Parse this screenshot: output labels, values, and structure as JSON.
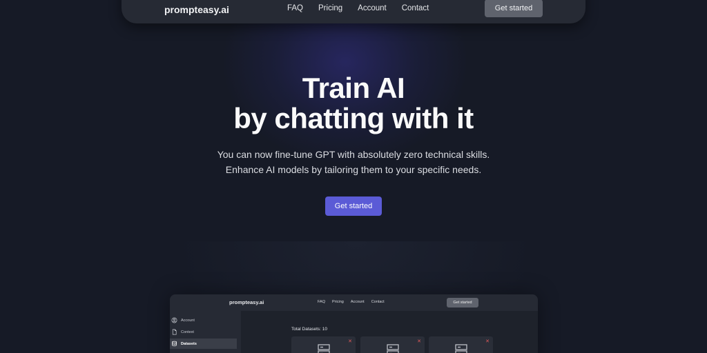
{
  "nav": {
    "logo": "prompteasy.ai",
    "links": [
      "FAQ",
      "Pricing",
      "Account",
      "Contact"
    ],
    "cta": "Get started"
  },
  "hero": {
    "title_line1": "Train AI",
    "title_line2": "by chatting with it",
    "subtitle_line1": "You can now fine-tune GPT with absolutely zero technical skills.",
    "subtitle_line2": "Enhance AI models by tailoring them to your specific needs.",
    "cta": "Get started",
    "cta_color": "#5b5bd6"
  },
  "preview": {
    "logo": "prompteasy.ai",
    "links": [
      "FAQ",
      "Pricing",
      "Account",
      "Contact"
    ],
    "cta": "Get started",
    "sidebar": [
      {
        "label": "Account",
        "icon": "user-circle-icon"
      },
      {
        "label": "Context",
        "icon": "document-icon"
      },
      {
        "label": "Datasets",
        "icon": "database-icon",
        "active": true
      }
    ],
    "total_label": "Total Datasets: 10",
    "card_close": "✕"
  }
}
